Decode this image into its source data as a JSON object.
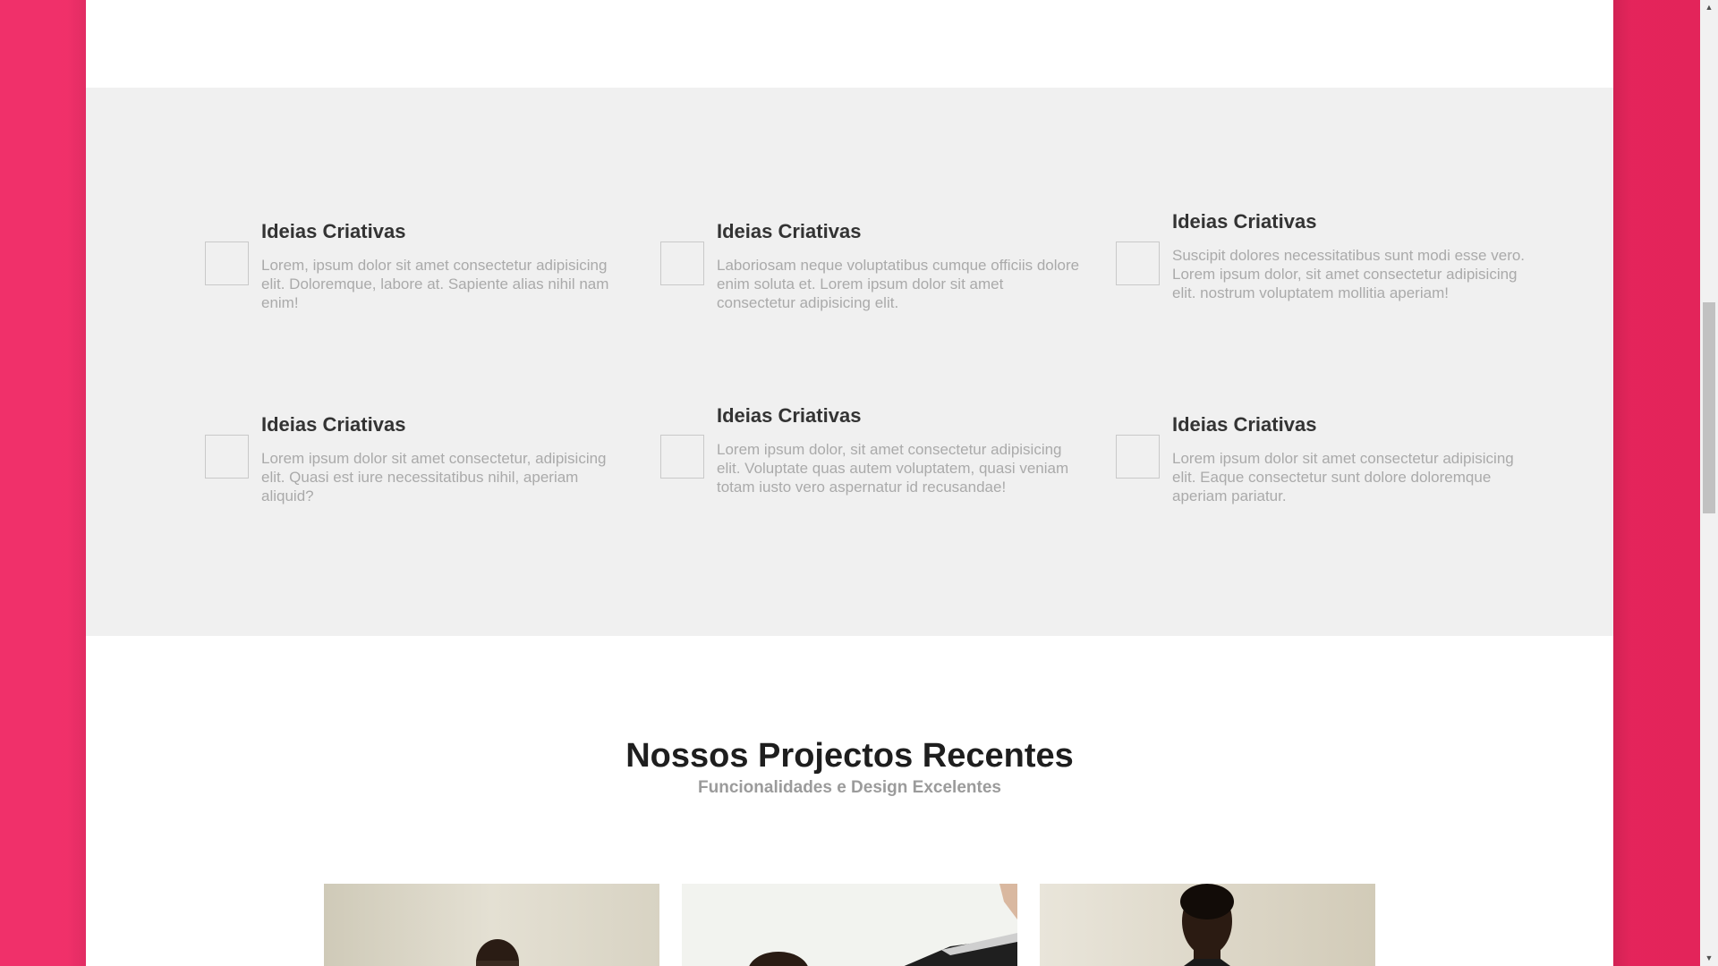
{
  "features": [
    {
      "title": "Ideias Criativas",
      "text": "Lorem, ipsum dolor sit amet consectetur adipisicing elit. Doloremque, labore at. Sapiente alias nihil nam enim!"
    },
    {
      "title": "Ideias Criativas",
      "text": "Laboriosam neque voluptatibus cumque officiis dolore enim soluta et. Lorem ipsum dolor sit amet consectetur adipisicing elit."
    },
    {
      "title": "Ideias Criativas",
      "text": "Suscipit dolores necessitatibus sunt modi esse vero. Lorem ipsum dolor, sit amet consectetur adipisicing elit. nostrum voluptatem mollitia aperiam!"
    },
    {
      "title": "Ideias Criativas",
      "text": "Lorem ipsum dolor sit amet consectetur, adipisicing elit. Quasi est iure necessitatibus nihil, aperiam aliquid?"
    },
    {
      "title": "Ideias Criativas",
      "text": "Lorem ipsum dolor, sit amet consectetur adipisicing elit. Voluptate quas autem voluptatem, quasi veniam totam iusto vero aspernatur id recusandae!"
    },
    {
      "title": "Ideias Criativas",
      "text": "Lorem ipsum dolor sit amet consectetur adipisicing elit. Eaque consectetur sunt dolore doloremque aperiam pariatur."
    }
  ],
  "projects": {
    "title": "Nossos Projectos Recentes",
    "subtitle": "Funcionalidades e Design Excelentes"
  },
  "colors": {
    "accent": "#e8285f",
    "section_bg": "#f0f0f0",
    "heading": "#333333",
    "body_text": "#aaaaaa"
  },
  "icons": {
    "scroll_up": "scroll-up-arrow-icon",
    "scroll_down": "scroll-down-arrow-icon"
  }
}
